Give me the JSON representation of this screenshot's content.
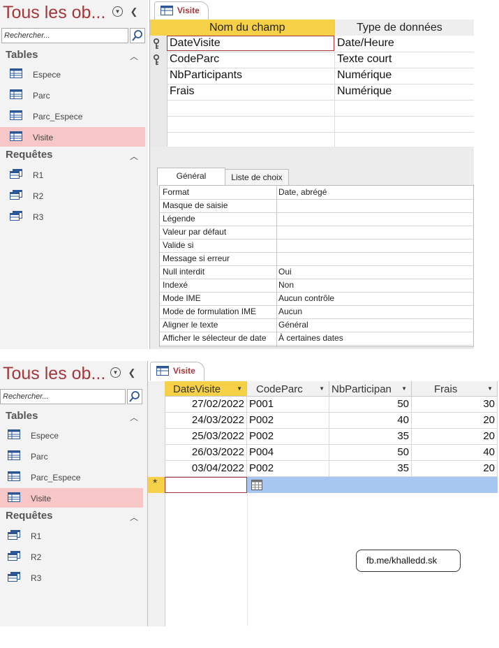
{
  "nav": {
    "title": "Tous les ob...",
    "search_placeholder": "Rechercher...",
    "groups": [
      {
        "label": "Tables",
        "items": [
          "Espece",
          "Parc",
          "Parc_Espece",
          "Visite"
        ],
        "selected": "Visite"
      },
      {
        "label": "Requêtes",
        "items": [
          "R1",
          "R2",
          "R3"
        ]
      }
    ]
  },
  "document_tab": "Visite",
  "design": {
    "col_headers": [
      "Nom du champ",
      "Type de données"
    ],
    "fields": [
      {
        "name": "DateVisite",
        "type": "Date/Heure",
        "key": true
      },
      {
        "name": "CodeParc",
        "type": "Texte court",
        "key": true
      },
      {
        "name": "NbParticipants",
        "type": "Numérique",
        "key": false
      },
      {
        "name": "Frais",
        "type": "Numérique",
        "key": false
      }
    ],
    "property_tabs": [
      "Général",
      "Liste de choix"
    ],
    "properties": [
      {
        "label": "Format",
        "value": "Date, abrégé"
      },
      {
        "label": "Masque de saisie",
        "value": ""
      },
      {
        "label": "Légende",
        "value": ""
      },
      {
        "label": "Valeur par défaut",
        "value": ""
      },
      {
        "label": "Valide si",
        "value": ""
      },
      {
        "label": "Message si erreur",
        "value": ""
      },
      {
        "label": "Null interdit",
        "value": "Oui"
      },
      {
        "label": "Indexé",
        "value": "Non"
      },
      {
        "label": "Mode IME",
        "value": "Aucun contrôle"
      },
      {
        "label": "Mode de formulation IME",
        "value": "Aucun"
      },
      {
        "label": "Aligner le texte",
        "value": "Général"
      },
      {
        "label": "Afficher le sélecteur de date",
        "value": "À certaines dates"
      }
    ]
  },
  "datasheet": {
    "columns": [
      "DateVisite",
      "CodeParc",
      "NbParticipan",
      "Frais"
    ],
    "rows": [
      [
        "27/02/2022",
        "P001",
        "50",
        "30"
      ],
      [
        "24/03/2022",
        "P002",
        "40",
        "20"
      ],
      [
        "25/03/2022",
        "P002",
        "35",
        "20"
      ],
      [
        "26/03/2022",
        "P004",
        "50",
        "40"
      ],
      [
        "03/04/2022",
        "P002",
        "35",
        "20"
      ]
    ],
    "new_record_marker": "*"
  },
  "watermark": "fb.me/khalledd.sk",
  "colors": {
    "accent": "#a4373a",
    "selected_bg": "#f7c6c7",
    "field_header": "#f6d046",
    "new_row": "#a7c7f0"
  }
}
